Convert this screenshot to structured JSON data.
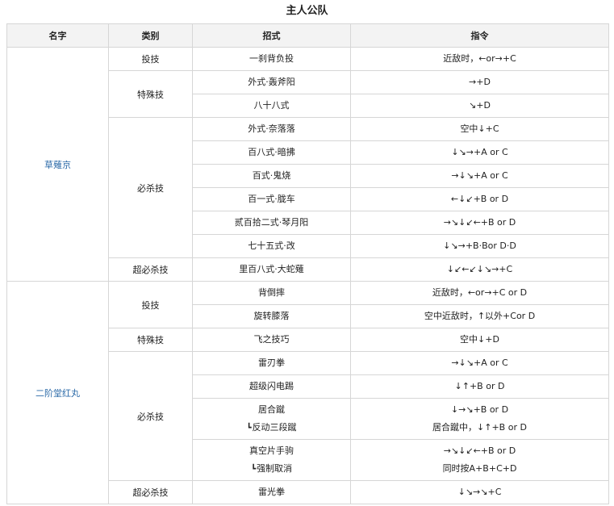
{
  "title": "主人公队",
  "headers": [
    "名字",
    "类别",
    "招式",
    "指令"
  ],
  "characters": [
    {
      "name": "草薙京",
      "groups": [
        {
          "category": "投技",
          "moves": [
            {
              "lines": [
                {
                  "move": "一刹背负投",
                  "command": "近敌时，←or→+C"
                }
              ]
            }
          ]
        },
        {
          "category": "特殊技",
          "moves": [
            {
              "lines": [
                {
                  "move": "外式·轰斧阳",
                  "command": "→+D"
                }
              ]
            },
            {
              "lines": [
                {
                  "move": "八十八式",
                  "command": "↘+D"
                }
              ]
            }
          ]
        },
        {
          "category": "必杀技",
          "moves": [
            {
              "lines": [
                {
                  "move": "外式·奈落落",
                  "command": "空中↓+C"
                }
              ]
            },
            {
              "lines": [
                {
                  "move": "百八式·暗拂",
                  "command": "↓↘→+A or C"
                }
              ]
            },
            {
              "lines": [
                {
                  "move": "百式·鬼烧",
                  "command": "→↓↘+A or C"
                }
              ]
            },
            {
              "lines": [
                {
                  "move": "百一式·胧车",
                  "command": "←↓↙+B or D"
                }
              ]
            },
            {
              "lines": [
                {
                  "move": "贰百拾二式·琴月阳",
                  "command": "→↘↓↙←+B or D"
                }
              ]
            },
            {
              "lines": [
                {
                  "move": "七十五式·改",
                  "command": "↓↘→+B·Bor D·D"
                }
              ]
            }
          ]
        },
        {
          "category": "超必杀技",
          "moves": [
            {
              "lines": [
                {
                  "move": "里百八式·大蛇薙",
                  "command": "↓↙←↙↓↘→+C"
                }
              ]
            }
          ]
        }
      ]
    },
    {
      "name": "二阶堂红丸",
      "groups": [
        {
          "category": "投技",
          "moves": [
            {
              "lines": [
                {
                  "move": "背倒摔",
                  "command": "近敌时，←or→+C or D"
                }
              ]
            },
            {
              "lines": [
                {
                  "move": "旋转膝落",
                  "command": "空中近敌时，↑以外+Cor D"
                }
              ]
            }
          ]
        },
        {
          "category": "特殊技",
          "moves": [
            {
              "lines": [
                {
                  "move": "飞之技巧",
                  "command": "空中↓+D"
                }
              ]
            }
          ]
        },
        {
          "category": "必杀技",
          "moves": [
            {
              "lines": [
                {
                  "move": "雷刃拳",
                  "command": "→↓↘+A or C"
                }
              ]
            },
            {
              "lines": [
                {
                  "move": "超级闪电踢",
                  "command": "↓↑+B or D"
                }
              ]
            },
            {
              "lines": [
                {
                  "move": "居合蹴",
                  "command": "↓→↘+B or D"
                },
                {
                  "mark": "┗",
                  "move": "反动三段蹴",
                  "command": "居合蹴中，↓↑+B or D"
                }
              ]
            },
            {
              "lines": [
                {
                  "move": "真空片手驹",
                  "command": "→↘↓↙←+B or D"
                },
                {
                  "mark": "┗",
                  "move": "强制取消",
                  "command": "同时按A+B+C+D"
                }
              ]
            }
          ]
        },
        {
          "category": "超必杀技",
          "moves": [
            {
              "lines": [
                {
                  "move": "雷光拳",
                  "command": "↓↘→↘+C"
                }
              ]
            }
          ]
        }
      ]
    }
  ]
}
